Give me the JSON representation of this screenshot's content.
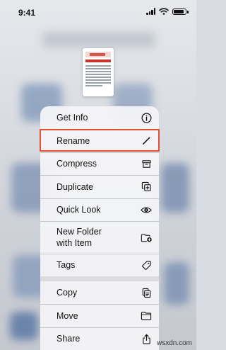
{
  "status_bar": {
    "time": "9:41",
    "battery_level": 0.9
  },
  "menu": {
    "items": [
      {
        "label": "Get Info",
        "icon": "info-icon"
      },
      {
        "label": "Rename",
        "icon": "pencil-icon",
        "highlighted": true
      },
      {
        "label": "Compress",
        "icon": "archive-box-icon"
      },
      {
        "label": "Duplicate",
        "icon": "duplicate-icon"
      },
      {
        "label": "Quick Look",
        "icon": "eye-icon"
      },
      {
        "label": "New Folder\nwith Item",
        "icon": "folder-badge-plus-icon"
      },
      {
        "label": "Tags",
        "icon": "tag-icon"
      },
      {
        "label": "Copy",
        "icon": "copy-icon"
      },
      {
        "label": "Move",
        "icon": "folder-icon"
      },
      {
        "label": "Share",
        "icon": "share-icon"
      }
    ]
  },
  "colors": {
    "highlight_border": "#e0502f",
    "menu_background": "#f4f4f6"
  },
  "watermark": "wsxdn.com"
}
